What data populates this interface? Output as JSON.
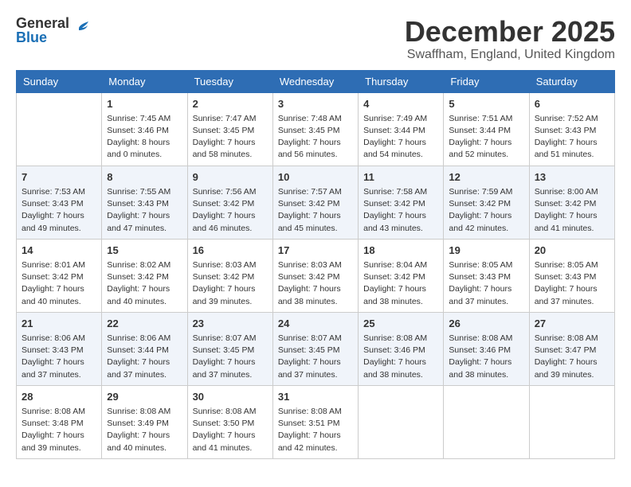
{
  "header": {
    "logo_general": "General",
    "logo_blue": "Blue",
    "month_title": "December 2025",
    "location": "Swaffham, England, United Kingdom"
  },
  "days_of_week": [
    "Sunday",
    "Monday",
    "Tuesday",
    "Wednesday",
    "Thursday",
    "Friday",
    "Saturday"
  ],
  "weeks": [
    [
      {
        "day": "",
        "info": ""
      },
      {
        "day": "1",
        "info": "Sunrise: 7:45 AM\nSunset: 3:46 PM\nDaylight: 8 hours\nand 0 minutes."
      },
      {
        "day": "2",
        "info": "Sunrise: 7:47 AM\nSunset: 3:45 PM\nDaylight: 7 hours\nand 58 minutes."
      },
      {
        "day": "3",
        "info": "Sunrise: 7:48 AM\nSunset: 3:45 PM\nDaylight: 7 hours\nand 56 minutes."
      },
      {
        "day": "4",
        "info": "Sunrise: 7:49 AM\nSunset: 3:44 PM\nDaylight: 7 hours\nand 54 minutes."
      },
      {
        "day": "5",
        "info": "Sunrise: 7:51 AM\nSunset: 3:44 PM\nDaylight: 7 hours\nand 52 minutes."
      },
      {
        "day": "6",
        "info": "Sunrise: 7:52 AM\nSunset: 3:43 PM\nDaylight: 7 hours\nand 51 minutes."
      }
    ],
    [
      {
        "day": "7",
        "info": "Sunrise: 7:53 AM\nSunset: 3:43 PM\nDaylight: 7 hours\nand 49 minutes."
      },
      {
        "day": "8",
        "info": "Sunrise: 7:55 AM\nSunset: 3:43 PM\nDaylight: 7 hours\nand 47 minutes."
      },
      {
        "day": "9",
        "info": "Sunrise: 7:56 AM\nSunset: 3:42 PM\nDaylight: 7 hours\nand 46 minutes."
      },
      {
        "day": "10",
        "info": "Sunrise: 7:57 AM\nSunset: 3:42 PM\nDaylight: 7 hours\nand 45 minutes."
      },
      {
        "day": "11",
        "info": "Sunrise: 7:58 AM\nSunset: 3:42 PM\nDaylight: 7 hours\nand 43 minutes."
      },
      {
        "day": "12",
        "info": "Sunrise: 7:59 AM\nSunset: 3:42 PM\nDaylight: 7 hours\nand 42 minutes."
      },
      {
        "day": "13",
        "info": "Sunrise: 8:00 AM\nSunset: 3:42 PM\nDaylight: 7 hours\nand 41 minutes."
      }
    ],
    [
      {
        "day": "14",
        "info": "Sunrise: 8:01 AM\nSunset: 3:42 PM\nDaylight: 7 hours\nand 40 minutes."
      },
      {
        "day": "15",
        "info": "Sunrise: 8:02 AM\nSunset: 3:42 PM\nDaylight: 7 hours\nand 40 minutes."
      },
      {
        "day": "16",
        "info": "Sunrise: 8:03 AM\nSunset: 3:42 PM\nDaylight: 7 hours\nand 39 minutes."
      },
      {
        "day": "17",
        "info": "Sunrise: 8:03 AM\nSunset: 3:42 PM\nDaylight: 7 hours\nand 38 minutes."
      },
      {
        "day": "18",
        "info": "Sunrise: 8:04 AM\nSunset: 3:42 PM\nDaylight: 7 hours\nand 38 minutes."
      },
      {
        "day": "19",
        "info": "Sunrise: 8:05 AM\nSunset: 3:43 PM\nDaylight: 7 hours\nand 37 minutes."
      },
      {
        "day": "20",
        "info": "Sunrise: 8:05 AM\nSunset: 3:43 PM\nDaylight: 7 hours\nand 37 minutes."
      }
    ],
    [
      {
        "day": "21",
        "info": "Sunrise: 8:06 AM\nSunset: 3:43 PM\nDaylight: 7 hours\nand 37 minutes."
      },
      {
        "day": "22",
        "info": "Sunrise: 8:06 AM\nSunset: 3:44 PM\nDaylight: 7 hours\nand 37 minutes."
      },
      {
        "day": "23",
        "info": "Sunrise: 8:07 AM\nSunset: 3:45 PM\nDaylight: 7 hours\nand 37 minutes."
      },
      {
        "day": "24",
        "info": "Sunrise: 8:07 AM\nSunset: 3:45 PM\nDaylight: 7 hours\nand 37 minutes."
      },
      {
        "day": "25",
        "info": "Sunrise: 8:08 AM\nSunset: 3:46 PM\nDaylight: 7 hours\nand 38 minutes."
      },
      {
        "day": "26",
        "info": "Sunrise: 8:08 AM\nSunset: 3:46 PM\nDaylight: 7 hours\nand 38 minutes."
      },
      {
        "day": "27",
        "info": "Sunrise: 8:08 AM\nSunset: 3:47 PM\nDaylight: 7 hours\nand 39 minutes."
      }
    ],
    [
      {
        "day": "28",
        "info": "Sunrise: 8:08 AM\nSunset: 3:48 PM\nDaylight: 7 hours\nand 39 minutes."
      },
      {
        "day": "29",
        "info": "Sunrise: 8:08 AM\nSunset: 3:49 PM\nDaylight: 7 hours\nand 40 minutes."
      },
      {
        "day": "30",
        "info": "Sunrise: 8:08 AM\nSunset: 3:50 PM\nDaylight: 7 hours\nand 41 minutes."
      },
      {
        "day": "31",
        "info": "Sunrise: 8:08 AM\nSunset: 3:51 PM\nDaylight: 7 hours\nand 42 minutes."
      },
      {
        "day": "",
        "info": ""
      },
      {
        "day": "",
        "info": ""
      },
      {
        "day": "",
        "info": ""
      }
    ]
  ]
}
